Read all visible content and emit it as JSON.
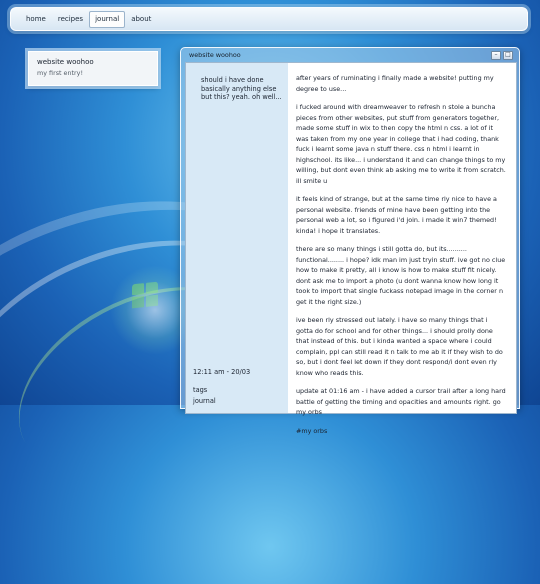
{
  "nav": {
    "items": [
      {
        "label": "home",
        "active": false
      },
      {
        "label": "recipes",
        "active": false
      },
      {
        "label": "journal",
        "active": true
      },
      {
        "label": "about",
        "active": false
      }
    ]
  },
  "sidebar": {
    "title": "website woohoo",
    "subtitle": "my first entry!"
  },
  "post": {
    "window_title": "website woohoo",
    "summary": "should i have done basically anything else but this? yeah. oh well...",
    "timestamp": "12:11 am - 20/03",
    "tags_label": "tags",
    "tag": "journal",
    "paragraphs": [
      "after years of ruminating i finally made a website! putting my degree to use...",
      "i fucked around with dreamweaver to refresh n stole a buncha pieces from other websites, put stuff from generators together, made some stuff in wix to then copy the html n css. a lot of it was taken from my one year in college that i had coding, thank fuck i learnt some java n stuff there. css n html i learnt in highschool. its like... i understand it and can change things to my willing, but dont even think ab asking me to write it from scratch. ill smite u",
      "it feels kind of strange, but at the same time rly nice to have a personal website. friends of mine have been getting into the personal web a lot, so i figured i'd join. i made it win7 themed! kinda! i hope it translates.",
      "there are so many things i still gotta do, but its.......... functional........ i hope? idk man im just tryin stuff. ive got no clue how to make it pretty, all i know is how to make stuff fit nicely. dont ask me to import a photo (u dont wanna know how long it took to import that single fuckass notepad image in the corner n get it the right size.)",
      "ive been rly stressed out lately. i have so many things that i gotta do for school and for other things... i should prolly done that instead of this. but i kinda wanted a space where i could complain, ppl can still read it n talk to me ab it if they wish to do so, but i dont feel let down if they dont respond/i dont even rly know who reads this.",
      "update at 01:16 am - i have added a cursor trail after a long hard battle of getting the timing and opacities and amounts right. go my orbs"
    ],
    "hashtag": "#my orbs"
  },
  "window_controls": {
    "minimize": "–",
    "maximize": "□"
  },
  "colors": {
    "desktop_blue": "#1b62b6",
    "meta_column": "#d8e9f6",
    "text": "#1b2330"
  }
}
